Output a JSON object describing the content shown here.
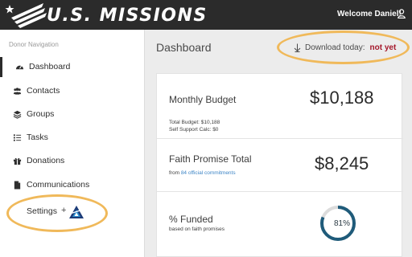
{
  "header": {
    "logo_text": "U.S. MISSIONS",
    "welcome": "Welcome Daniel!",
    "icons": {
      "logo": "stars-stripes-logo",
      "user": "user-icon"
    }
  },
  "sidebar": {
    "heading": "Donor Navigation",
    "items": [
      {
        "label": "Dashboard",
        "icon": "dashboard-icon",
        "active": true
      },
      {
        "label": "Contacts",
        "icon": "users-icon"
      },
      {
        "label": "Groups",
        "icon": "layers-icon"
      },
      {
        "label": "Tasks",
        "icon": "tasks-icon"
      },
      {
        "label": "Donations",
        "icon": "gift-icon"
      },
      {
        "label": "Communications",
        "icon": "document-icon"
      }
    ],
    "settings": {
      "label": "Settings",
      "plus": "+",
      "icon": "triangle-logo-icon"
    }
  },
  "main": {
    "title": "Dashboard",
    "download_label": "Download today:",
    "download_status": "not yet",
    "download_icon": "download-arrow-icon"
  },
  "stats": {
    "budget": {
      "title": "Monthly Budget",
      "value": "$10,188",
      "detail_1": "Total Budget: $10,188",
      "detail_2": "Self Support Calc: $0"
    },
    "faith": {
      "title": "Faith Promise Total",
      "value": "$8,245",
      "sub_prefix": "from",
      "sub_link": "84 official commitments"
    },
    "funded": {
      "title": "% Funded",
      "sub": "based on faith promises",
      "value": "81%",
      "fraction": 0.81
    }
  },
  "colors": {
    "topbar": "#2b2b2b",
    "highlight_ring": "#f0b95a",
    "status_red": "#a5182b",
    "link_blue": "#3d85c6",
    "progress_ring": "#1f5b7a"
  }
}
